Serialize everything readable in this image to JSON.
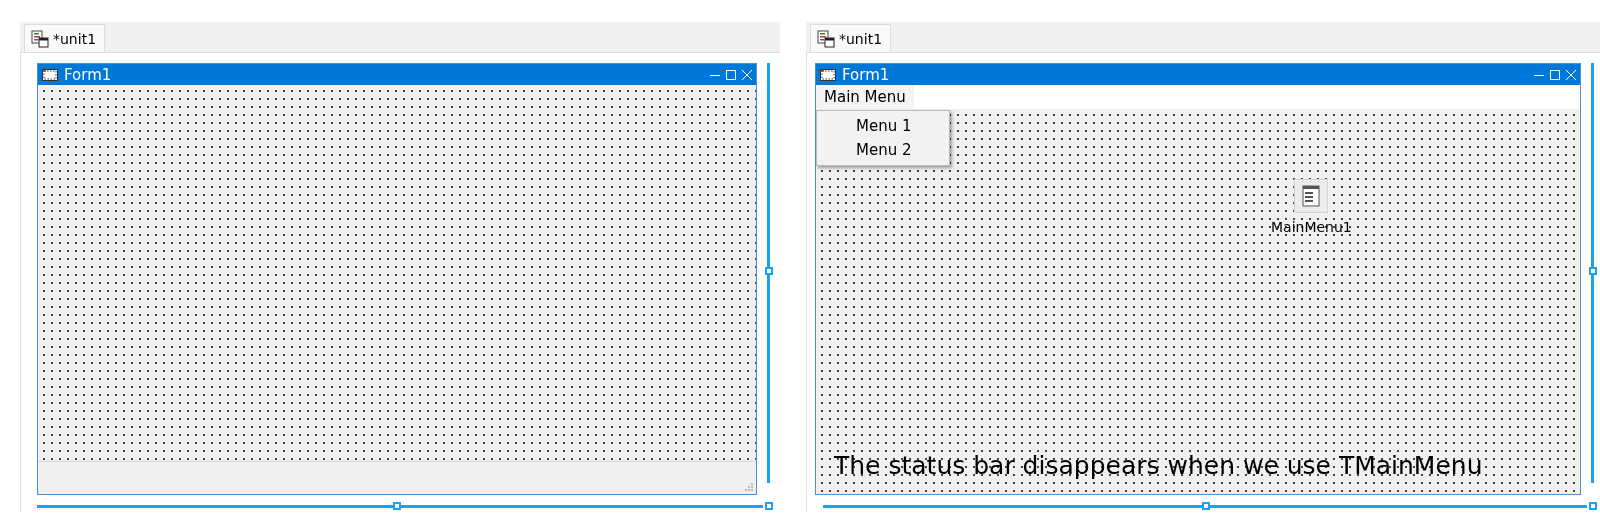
{
  "panels": [
    {
      "tab": {
        "label": "*unit1",
        "selected": true
      },
      "form": {
        "title": "Form1",
        "status_bar": true
      }
    },
    {
      "tab": {
        "label": "*unit1",
        "selected": true
      },
      "form": {
        "title": "Form1",
        "menu": {
          "label": "Main Menu",
          "expanded": true,
          "items": [
            "Menu 1",
            "Menu 2"
          ]
        },
        "component": {
          "label": "MainMenu1"
        },
        "note": "The status bar disappears when we use TMainMenu",
        "status_bar": false
      }
    }
  ]
}
